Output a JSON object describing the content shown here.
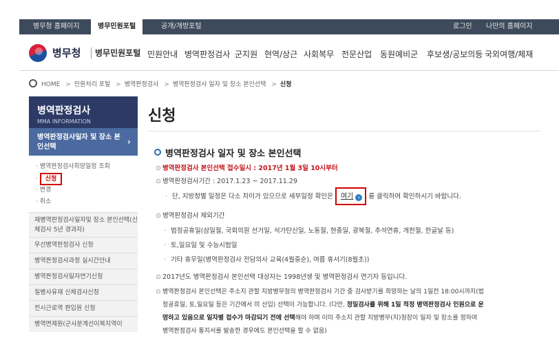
{
  "top": {
    "tabs": [
      "병무청 홈페이지",
      "병무민원포털",
      "공개/개방포털"
    ],
    "login": "로그인",
    "my_homepage": "나만의 홈페이지"
  },
  "header": {
    "logo_text": "병무청",
    "logo_sub": "병무민원포털",
    "nav": [
      "민원안내",
      "병역판정검사",
      "군지원",
      "현역/상근",
      "사회복무",
      "전문산업",
      "동원예비군",
      "후보생/공보의등",
      "국외여행/체재"
    ]
  },
  "breadcrumb": {
    "home": "HOME",
    "items": [
      "민원처리 포털",
      "병역판정검사",
      "병역판정검사 일자 및 장소 본인선택"
    ],
    "current": "신청"
  },
  "sidebar": {
    "title": "병역판정검사",
    "subtitle": "MMA INFORMATION",
    "active": "병역판정검사일자 및 장소 본인선택",
    "subitems": [
      "병역판정검사희망일정 조회",
      "신청",
      "변경",
      "취소"
    ],
    "items": [
      "재병역판정검사일자및 장소 본인선택(신체검사 5년 경과자)",
      "우선병역판정검사 신청",
      "병역판정검사과정 실시간안내",
      "병역판정검사일자연기신청",
      "질병사유재 신체검사신청",
      "전시근로역 편입원 신청",
      "병역면제원(군사분계선이북지역이"
    ]
  },
  "main": {
    "title": "신청",
    "section_title": "병역판정검사 일자 및 장소 본인선택",
    "notice": "병역판정검사 본인선택 접수일시 : 2017년 1월 3일 10시부터",
    "period": "병역판정검사기간 : 2017.1.23 ~ 2017.11.29",
    "schedule_pre": "단, 지방청별 일정은 다소 차이가 있으므로 세부일정 확인은",
    "here_link": "여기",
    "schedule_post": "를 클릭하여 확인하시기 바랍니다.",
    "exclude_title": "병역판정검사 제외기간",
    "exclude_items": [
      "법정공휴일(삼일절, 국회의원 선거일, 석가탄신일, 노동절, 현충일, 광복절, 추석연휴, 개천절, 한글날 등)",
      "토,일요일 및 수능시험일",
      "기타 휴무일(병역판정검사 전담의사 교육(4월중순), 여름 휴서기(8월초))"
    ],
    "target_note": "2017년도 병역판정검사 본인선택 대상자는 1998년생 및 병역판정검사 연기자 등입니다.",
    "p1_a": "병역판정검사 본인선택은 주소지 관할 지방병무청의 병역판정검사 기간 중 검사받기를 희망하는 날의 1일전 18:00시까지(법",
    "p1_b_pre": "정공휴일, 토,일요일 등은 기간에서 미 산입) 선택이 가능합니다. (다만, ",
    "p1_b_bold": "정밀검사를 위해 1일 적정 병역판정검사 인원으로 운",
    "p1_c_bold": "영하고 있음으로 일자별 접수가 마감되기 전에 선택",
    "p1_c_post": "해야 하며 이미 주소지 관할 지방병무(지)청장이 일자 및 장소를 정하여",
    "p1_d": "병역판정검사 통지서를 발송한 경우에도 본인선택을 할 수 없음)"
  }
}
